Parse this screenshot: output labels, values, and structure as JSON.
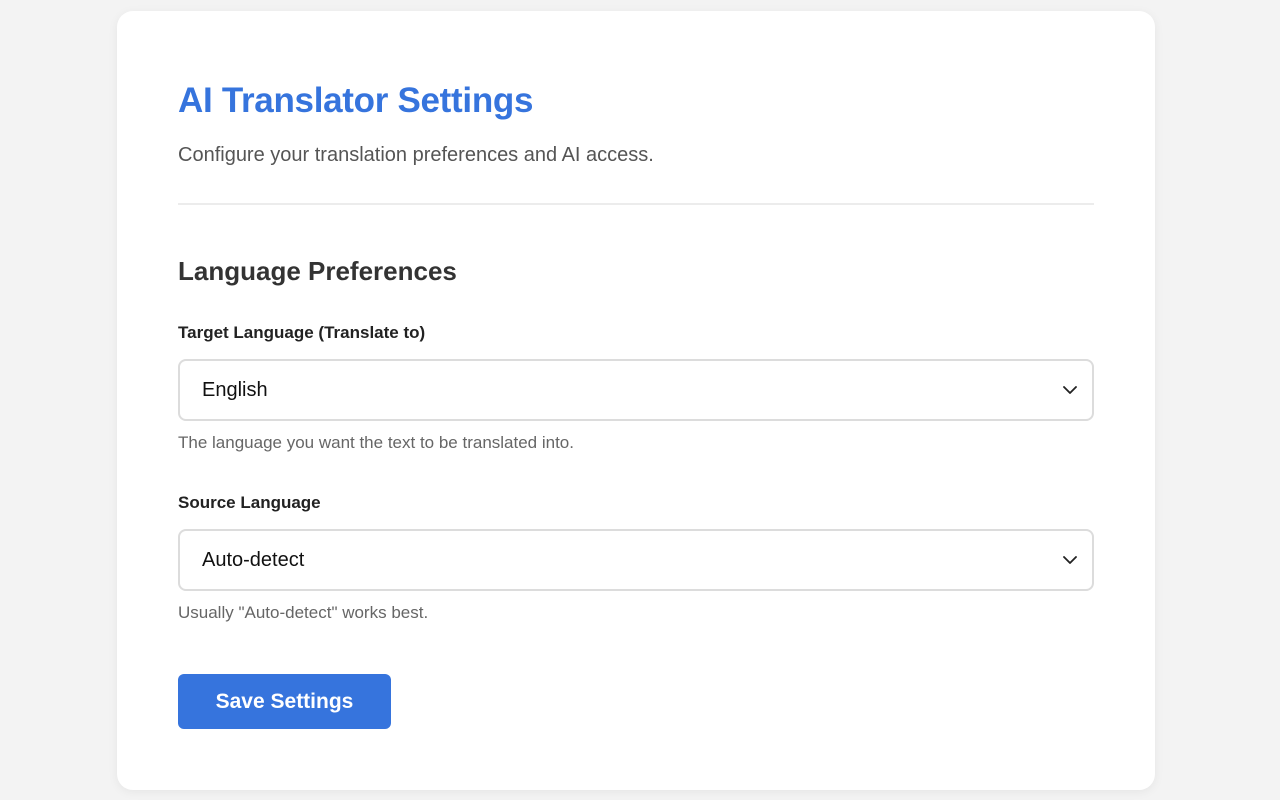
{
  "header": {
    "title": "AI Translator Settings",
    "subtitle": "Configure your translation preferences and AI access."
  },
  "language_preferences": {
    "section_title": "Language Preferences",
    "target_language": {
      "label": "Target Language (Translate to)",
      "selected": "English",
      "help": "The language you want the text to be translated into."
    },
    "source_language": {
      "label": "Source Language",
      "selected": "Auto-detect",
      "help": "Usually \"Auto-detect\" works best."
    }
  },
  "actions": {
    "save_label": "Save Settings"
  },
  "colors": {
    "accent": "#3674dd",
    "background": "#f3f3f3",
    "card": "#ffffff"
  },
  "icons": {
    "dropdown": "chevron-down-icon"
  }
}
